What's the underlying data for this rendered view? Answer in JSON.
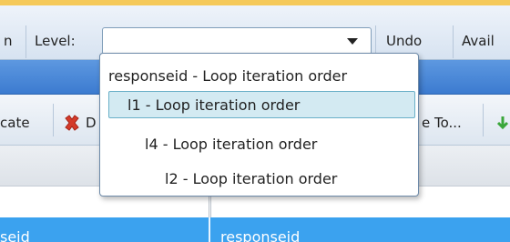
{
  "toolbar": {
    "cut_left_label": "n",
    "level_label": "Level:",
    "level_value": "",
    "undo_label": "Undo",
    "avail_label": "Avail"
  },
  "level_dropdown": {
    "options": [
      {
        "label": "responseid - Loop iteration order",
        "highlighted": false
      },
      {
        "label": "l1 - Loop iteration order",
        "highlighted": true
      },
      {
        "label": "l4 - Loop iteration order",
        "highlighted": false
      },
      {
        "label": "l2 - Loop iteration order",
        "highlighted": false
      }
    ]
  },
  "toolbar2": {
    "cut_left_label": "cate",
    "delete_partial_label": "D",
    "move_to_partial_label": "e To...",
    "delete_icon_color": "#d43a2a",
    "green_icon_color": "#3aa63a"
  },
  "grid": {
    "row_cells": [
      "seid",
      "responseid"
    ],
    "selected_row_color": "#3ba2ef"
  },
  "colors": {
    "top_accent": "#f5c95a",
    "blue_band": "#4a88d8"
  }
}
